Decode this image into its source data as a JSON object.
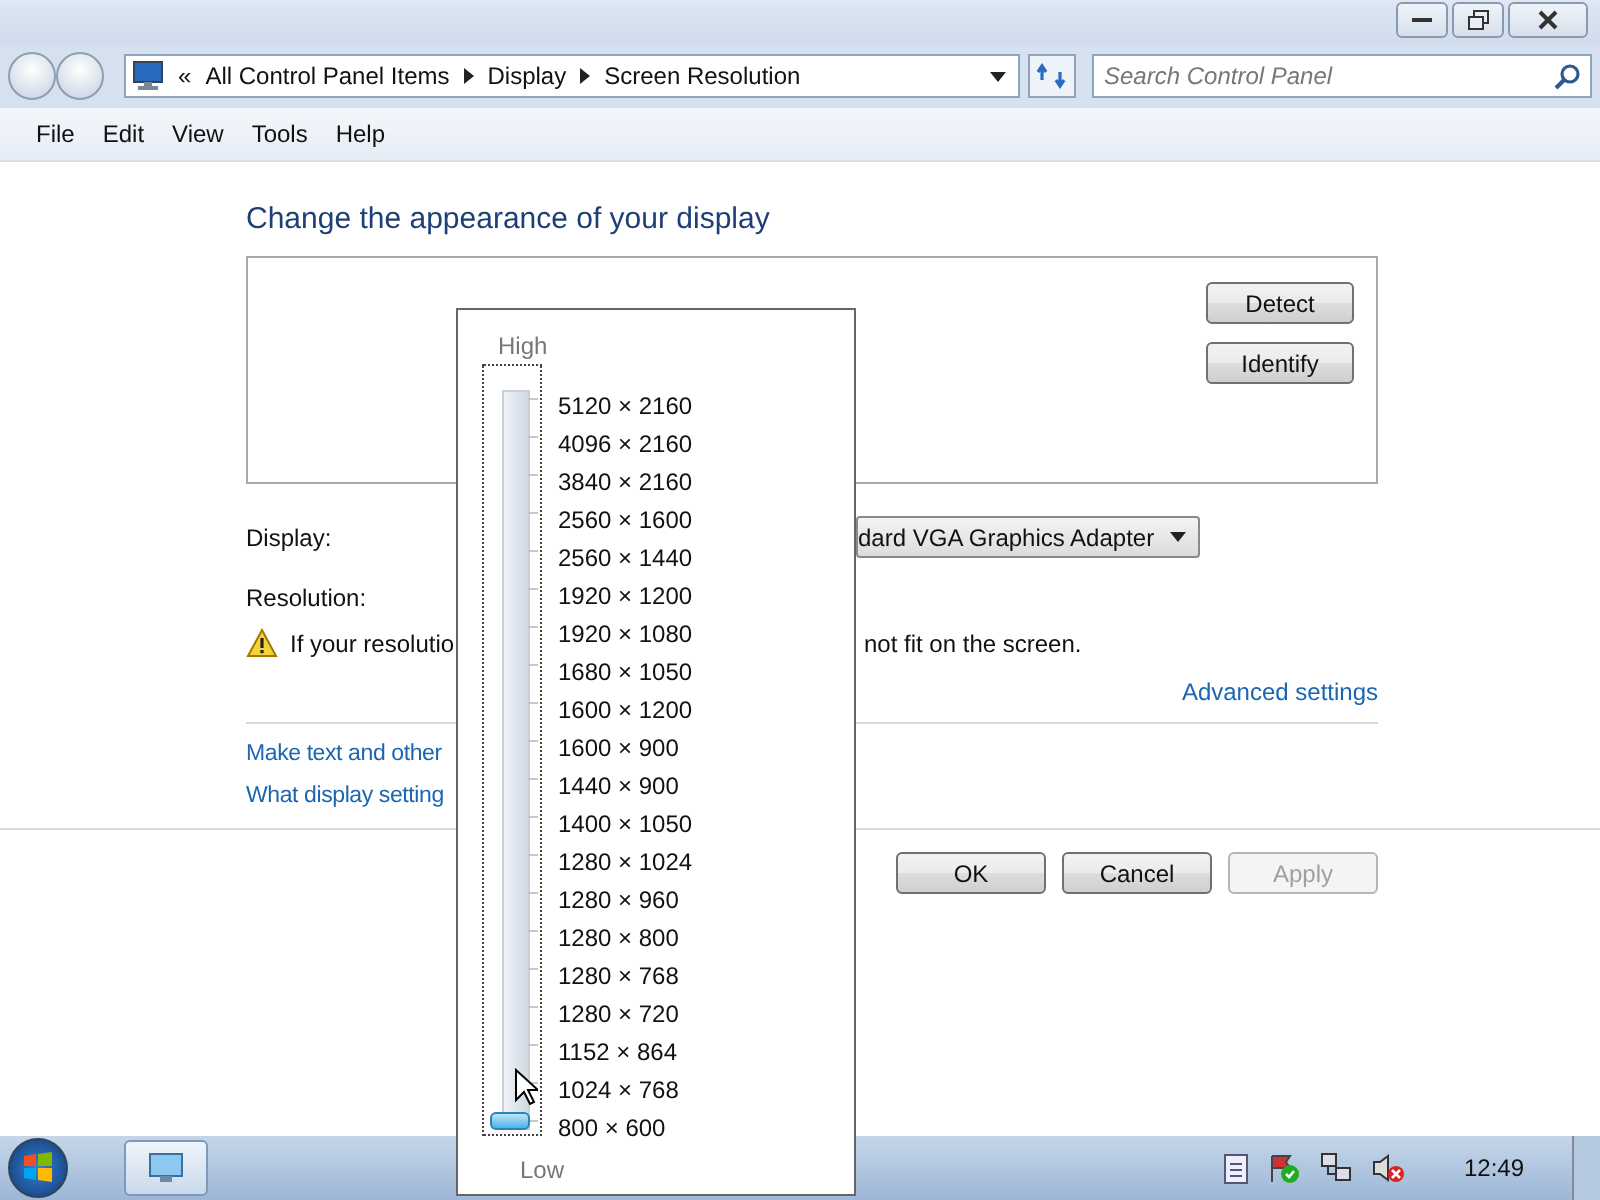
{
  "address_bar": {
    "overflow": "«",
    "crumbs": [
      "All Control Panel Items",
      "Display",
      "Screen Resolution"
    ]
  },
  "search": {
    "placeholder": "Search Control Panel"
  },
  "menu": [
    "File",
    "Edit",
    "View",
    "Tools",
    "Help"
  ],
  "heading": "Change the appearance of your display",
  "monitor_buttons": [
    "Detect",
    "Identify"
  ],
  "display": {
    "label": "Display:",
    "value": "dard VGA Graphics Adapter"
  },
  "resolution": {
    "label": "Resolution:"
  },
  "warning": {
    "left": "If your resolutio",
    "right": "not fit on the screen."
  },
  "advanced_link": "Advanced settings",
  "links": [
    "Make text and other",
    "What display setting"
  ],
  "buttons": [
    {
      "label": "OK",
      "disabled": false
    },
    {
      "label": "Cancel",
      "disabled": false
    },
    {
      "label": "Apply",
      "disabled": true
    }
  ],
  "resolution_popup": {
    "high": "High",
    "low": "Low",
    "level": 0,
    "options": [
      "5120 × 2160",
      "4096 × 2160",
      "3840 × 2160",
      "2560 × 1600",
      "2560 × 1440",
      "1920 × 1200",
      "1920 × 1080",
      "1680 × 1050",
      "1600 × 1200",
      "1600 × 900",
      "1440 × 900",
      "1400 × 1050",
      "1280 × 1024",
      "1280 × 960",
      "1280 × 800",
      "1280 × 768",
      "1280 × 720",
      "1152 × 864",
      "1024 × 768",
      "800 × 600"
    ]
  },
  "taskbar": {
    "clock": "12:49"
  }
}
